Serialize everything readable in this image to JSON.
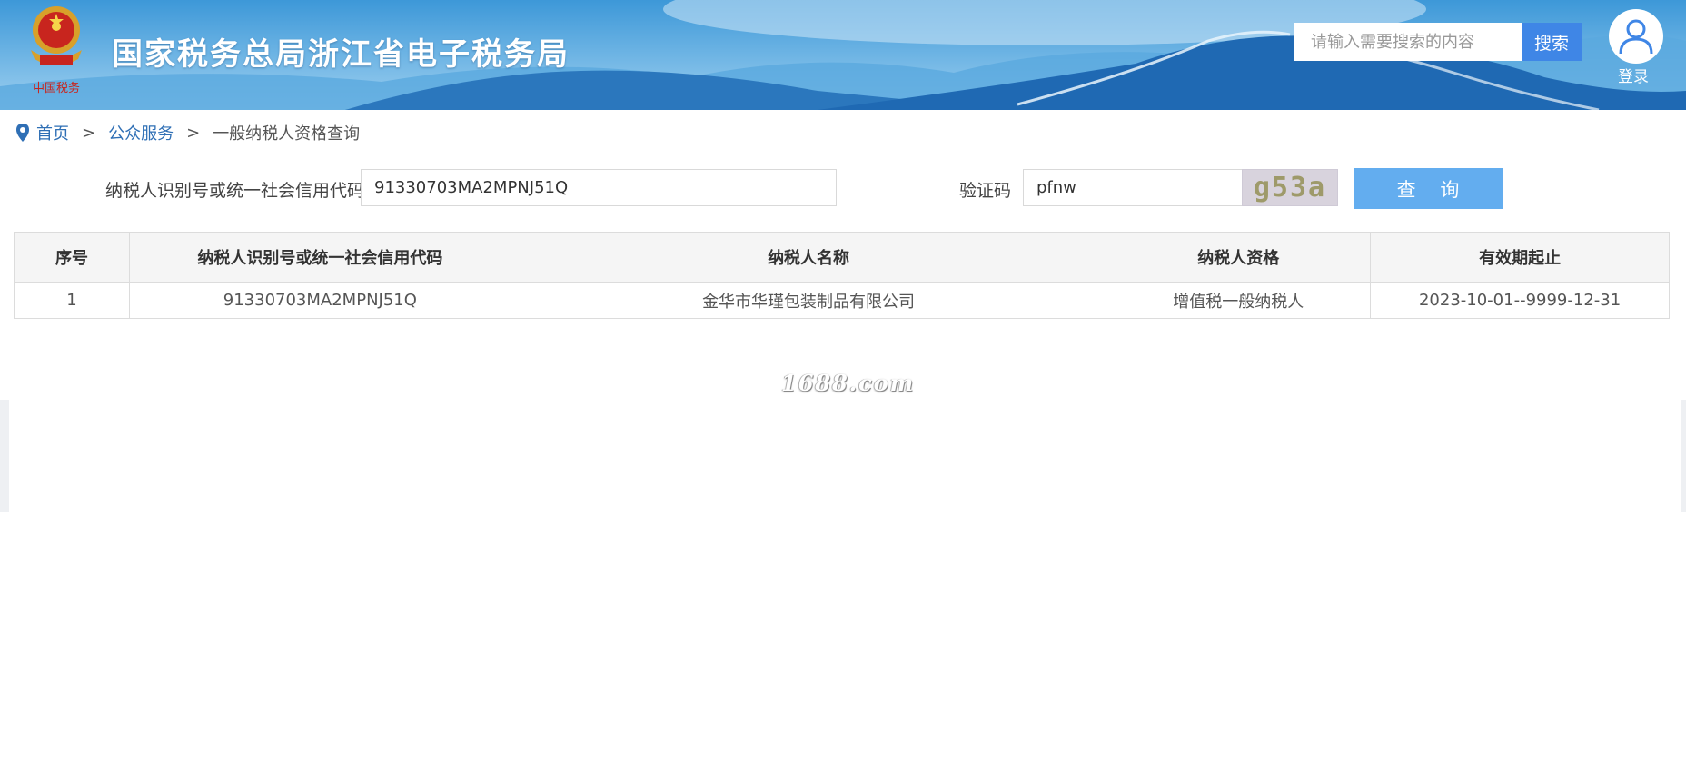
{
  "header": {
    "site_title": "国家税务总局浙江省电子税务局",
    "emblem_caption": "中国税务",
    "search_placeholder": "请输入需要搜索的内容",
    "search_button": "搜索",
    "login_label": "登录",
    "colors": {
      "banner": "#2f8fd4",
      "search_button": "#3f86e6"
    }
  },
  "breadcrumb": {
    "items": [
      "首页",
      "公众服务"
    ],
    "separator": ">",
    "current": "一般纳税人资格查询"
  },
  "form": {
    "id_label": "纳税人识别号或统一社会信用代码",
    "id_value": "91330703MA2MPNJ51Q",
    "captcha_label": "验证码",
    "captcha_value": "pfnw",
    "captcha_image_text": "g53a",
    "query_button": "查 询",
    "colors": {
      "query_button": "#63adef"
    }
  },
  "table": {
    "columns": [
      "序号",
      "纳税人识别号或统一社会信用代码",
      "纳税人名称",
      "纳税人资格",
      "有效期起止"
    ],
    "rows": [
      [
        "1",
        "91330703MA2MPNJ51Q",
        "金华市华瑾包装制品有限公司",
        "增值税一般纳税人",
        "2023-10-01--9999-12-31"
      ]
    ]
  },
  "watermark": "1688.com"
}
